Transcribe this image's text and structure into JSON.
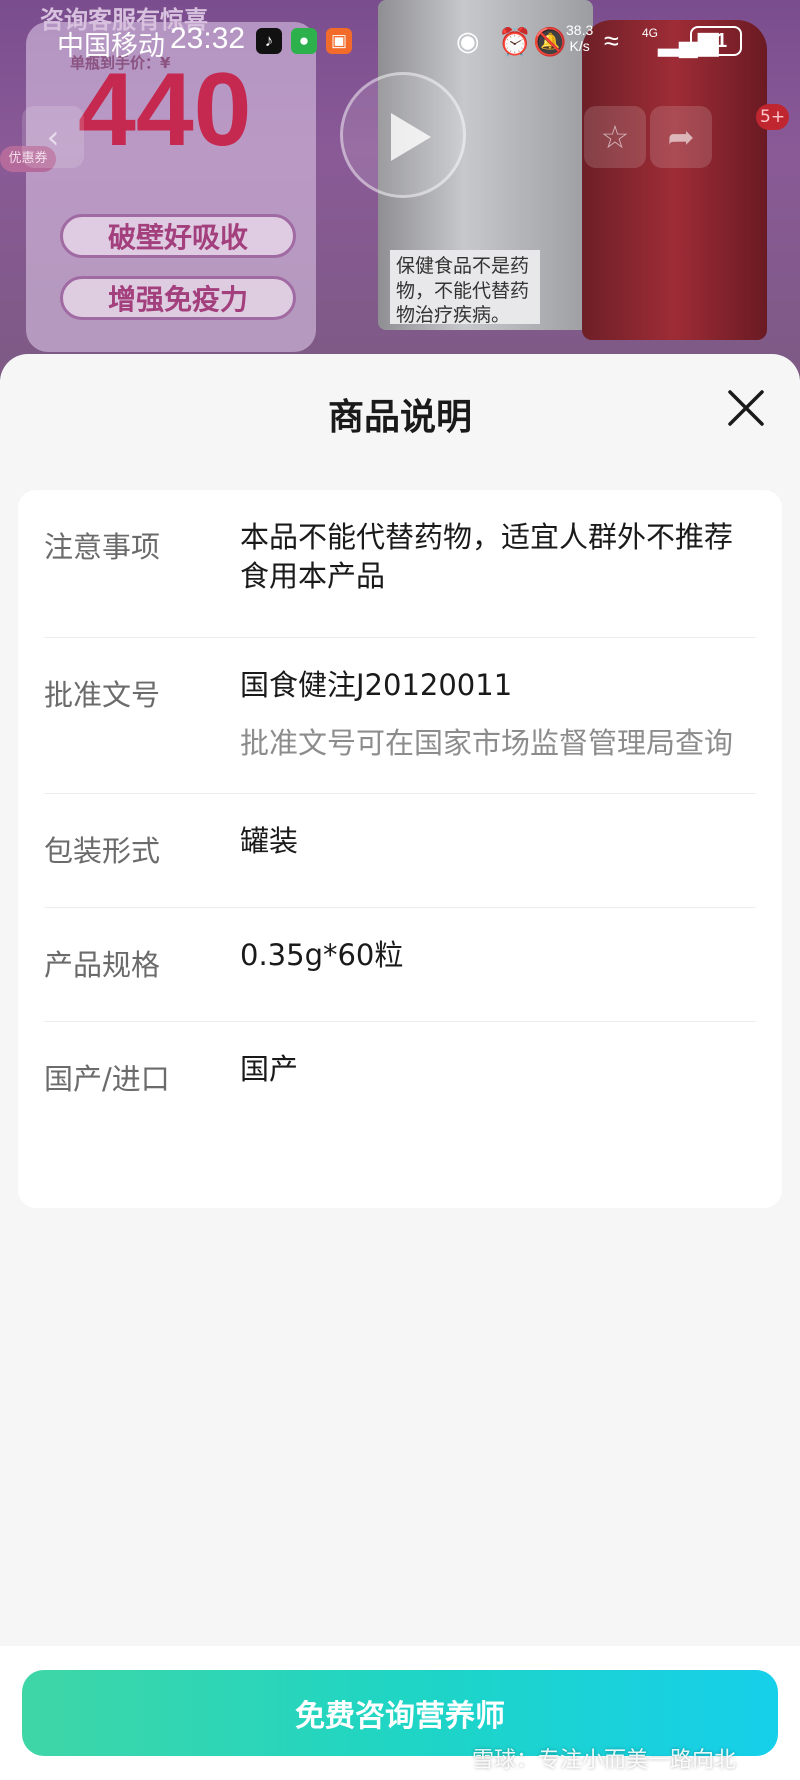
{
  "background": {
    "promo_banner": "咨询客服有惊喜",
    "price_label": "单瓶到手价：¥",
    "price": "440",
    "chip_1": "破壁好吸收",
    "chip_2": "增强免疫力",
    "stamp": "优惠券",
    "tin_label": "保健食品不是药物，不能代替药物治疗疾病。",
    "badge_count": "5+"
  },
  "status_bar": {
    "carrier": "中国移动",
    "time": "23:32",
    "net_speed_value": "38.3",
    "net_speed_unit": "K/s",
    "network_type": "4G",
    "battery": "81"
  },
  "sheet": {
    "title": "商品说明",
    "rows": [
      {
        "label": "注意事项",
        "value": "本品不能代替药物，适宜人群外不推荐食用本产品",
        "sub": ""
      },
      {
        "label": "批准文号",
        "value": "国食健注J20120011",
        "sub": "批准文号可在国家市场监督管理局查询"
      },
      {
        "label": "包装形式",
        "value": "罐装",
        "sub": ""
      },
      {
        "label": "产品规格",
        "value": "0.35g*60粒",
        "sub": ""
      },
      {
        "label": "国产/进口",
        "value": "国产",
        "sub": ""
      }
    ]
  },
  "footer": {
    "cta_label": "免费咨询营养师",
    "watermark": "雪球：专注小而美一路向北"
  },
  "colors": {
    "cta_gradient_start": "#3fd6a6",
    "cta_gradient_end": "#16cfea",
    "price_red": "#c5294f"
  },
  "icons": [
    "play-icon",
    "back-icon",
    "star-icon",
    "share-icon",
    "close-icon",
    "eye-icon",
    "alarm-icon",
    "mute-icon",
    "wifi-icon",
    "signal-icon",
    "battery-icon"
  ]
}
